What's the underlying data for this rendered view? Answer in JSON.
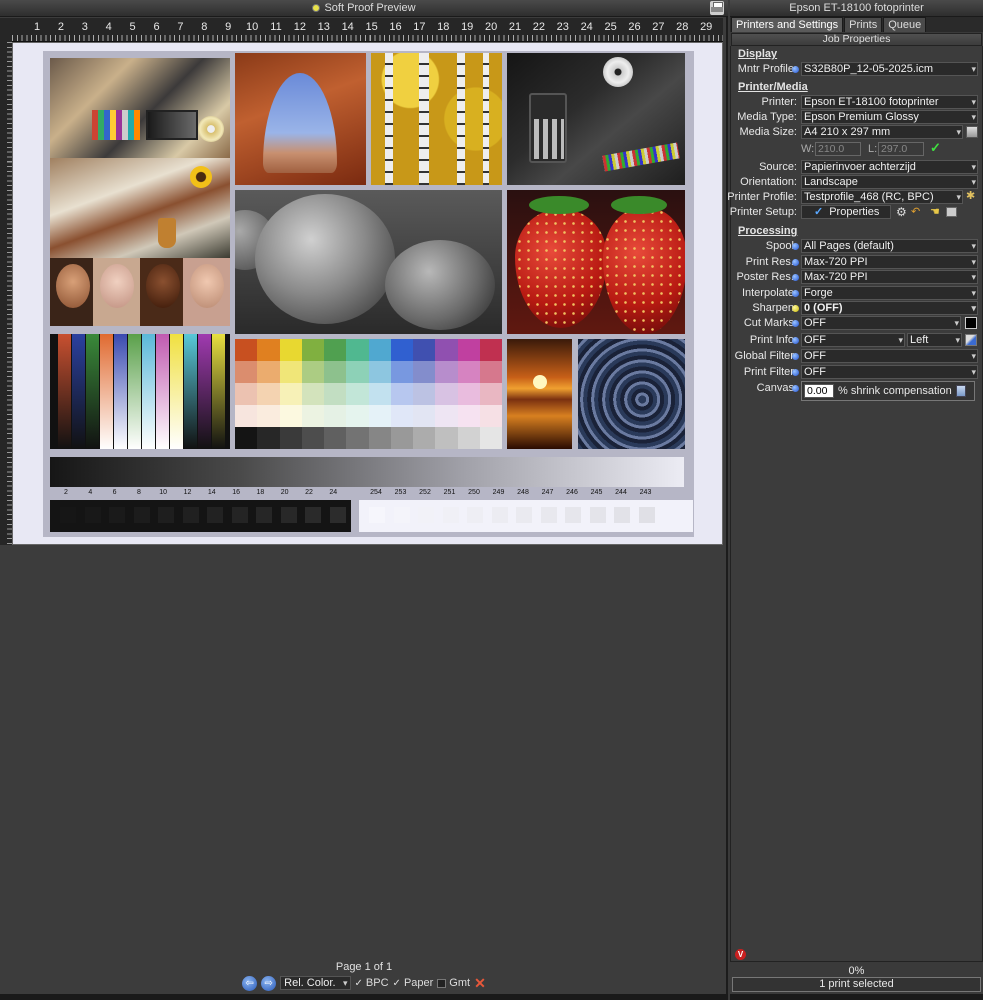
{
  "preview": {
    "title": "Soft Proof Preview",
    "ruler_numbers": [
      "1",
      "2",
      "3",
      "4",
      "5",
      "6",
      "7",
      "8",
      "9",
      "10",
      "11",
      "12",
      "13",
      "14",
      "15",
      "16",
      "17",
      "18",
      "19",
      "20",
      "21",
      "22",
      "23",
      "24",
      "25",
      "26",
      "27",
      "28",
      "29"
    ],
    "gradient_labels": [
      "2",
      "4",
      "6",
      "8",
      "10",
      "12",
      "14",
      "16",
      "18",
      "20",
      "22",
      "24",
      "254",
      "253",
      "252",
      "251",
      "250",
      "249",
      "248",
      "247",
      "246",
      "245",
      "244",
      "243"
    ],
    "page_info": "Page 1 of 1",
    "intent": "Rel. Color.",
    "bpc_label": "BPC",
    "paper_label": "Paper",
    "gmt_label": "Gmt"
  },
  "panel": {
    "title": "Epson ET-18100 fotoprinter",
    "tabs": [
      "Printers and Settings",
      "Prints",
      "Queue"
    ],
    "job_header": "Job Properties",
    "sections": {
      "display": "Display",
      "printer_media": "Printer/Media",
      "processing": "Processing"
    },
    "fields": {
      "mntr_profile": {
        "label": "Mntr Profile:",
        "value": "S32B80P_12-05-2025.icm"
      },
      "printer": {
        "label": "Printer:",
        "value": "Epson ET-18100 fotoprinter"
      },
      "media_type": {
        "label": "Media Type:",
        "value": "Epson Premium Glossy"
      },
      "media_size": {
        "label": "Media Size:",
        "value": "A4 210 x 297 mm"
      },
      "width": {
        "label": "W:",
        "value": "210.0"
      },
      "length": {
        "label": "L:",
        "value": "297.0"
      },
      "source": {
        "label": "Source:",
        "value": "Papierinvoer achterzijd"
      },
      "orientation": {
        "label": "Orientation:",
        "value": "Landscape"
      },
      "printer_profile": {
        "label": "Printer Profile:",
        "value": "Testprofile_468 (RC, BPC)"
      },
      "printer_setup": {
        "label": "Printer Setup:",
        "button": "Properties"
      },
      "spool": {
        "label": "Spool:",
        "value": "All Pages (default)"
      },
      "print_res": {
        "label": "Print Res.:",
        "value": "Max-720 PPI"
      },
      "poster_res": {
        "label": "Poster Res.:",
        "value": "Max-720 PPI"
      },
      "interpolate": {
        "label": "Interpolate:",
        "value": "Forge"
      },
      "sharpen": {
        "label": "Sharpen:",
        "value": "0 (OFF)"
      },
      "cut_marks": {
        "label": "Cut Marks:",
        "value": "OFF"
      },
      "print_info": {
        "label": "Print Info:",
        "value": "OFF",
        "position": "Left"
      },
      "global_filter": {
        "label": "Global Filter:",
        "value": "OFF"
      },
      "print_filter": {
        "label": "Print Filter:",
        "value": "OFF"
      },
      "canvas": {
        "label": "Canvas:",
        "value": "0.00",
        "suffix": "% shrink compensation"
      }
    },
    "badge": "V",
    "progress": "0%",
    "status": "1 print selected"
  }
}
